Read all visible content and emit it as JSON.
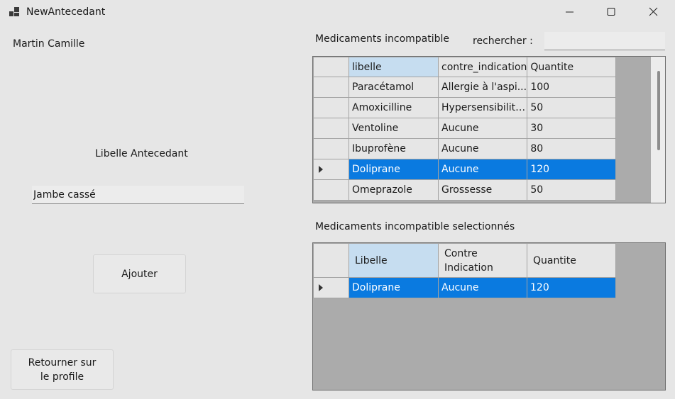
{
  "window": {
    "title": "NewAntecedant",
    "controls": {
      "minimize": "minimize-icon",
      "maximize": "maximize-icon",
      "close": "close-icon"
    }
  },
  "left": {
    "patient_name": "Martin Camille",
    "libelle_label": "Libelle Antecedant",
    "libelle_value": "Jambe cassé",
    "add_button": "Ajouter",
    "back_button": "Retourner sur le profile"
  },
  "right": {
    "grid1_title": "Medicaments incompatible",
    "search_label": "rechercher :",
    "search_value": "",
    "grid1": {
      "columns": [
        "libelle",
        "contre_indication",
        "Quantite"
      ],
      "rows": [
        [
          "Paracétamol",
          "Allergie à l'aspi...",
          "100"
        ],
        [
          "Amoxicilline",
          "Hypersensibilité...",
          "50"
        ],
        [
          "Ventoline",
          "Aucune",
          "30"
        ],
        [
          "Ibuprofène",
          "Aucune",
          "80"
        ],
        [
          "Doliprane",
          "Aucune",
          "120"
        ],
        [
          "Omeprazole",
          "Grossesse",
          "50"
        ]
      ],
      "selected_row": 4
    },
    "grid2_title": "Medicaments incompatible selectionnés",
    "grid2": {
      "columns": [
        "Libelle",
        "Contre Indication",
        "Quantite"
      ],
      "rows": [
        [
          "Doliprane",
          "Aucune",
          "120"
        ]
      ],
      "selected_row": 0
    }
  },
  "colors": {
    "selection": "#0a7ae0",
    "sorted_header": "#c6ddf0",
    "grid_background": "#ababab"
  }
}
